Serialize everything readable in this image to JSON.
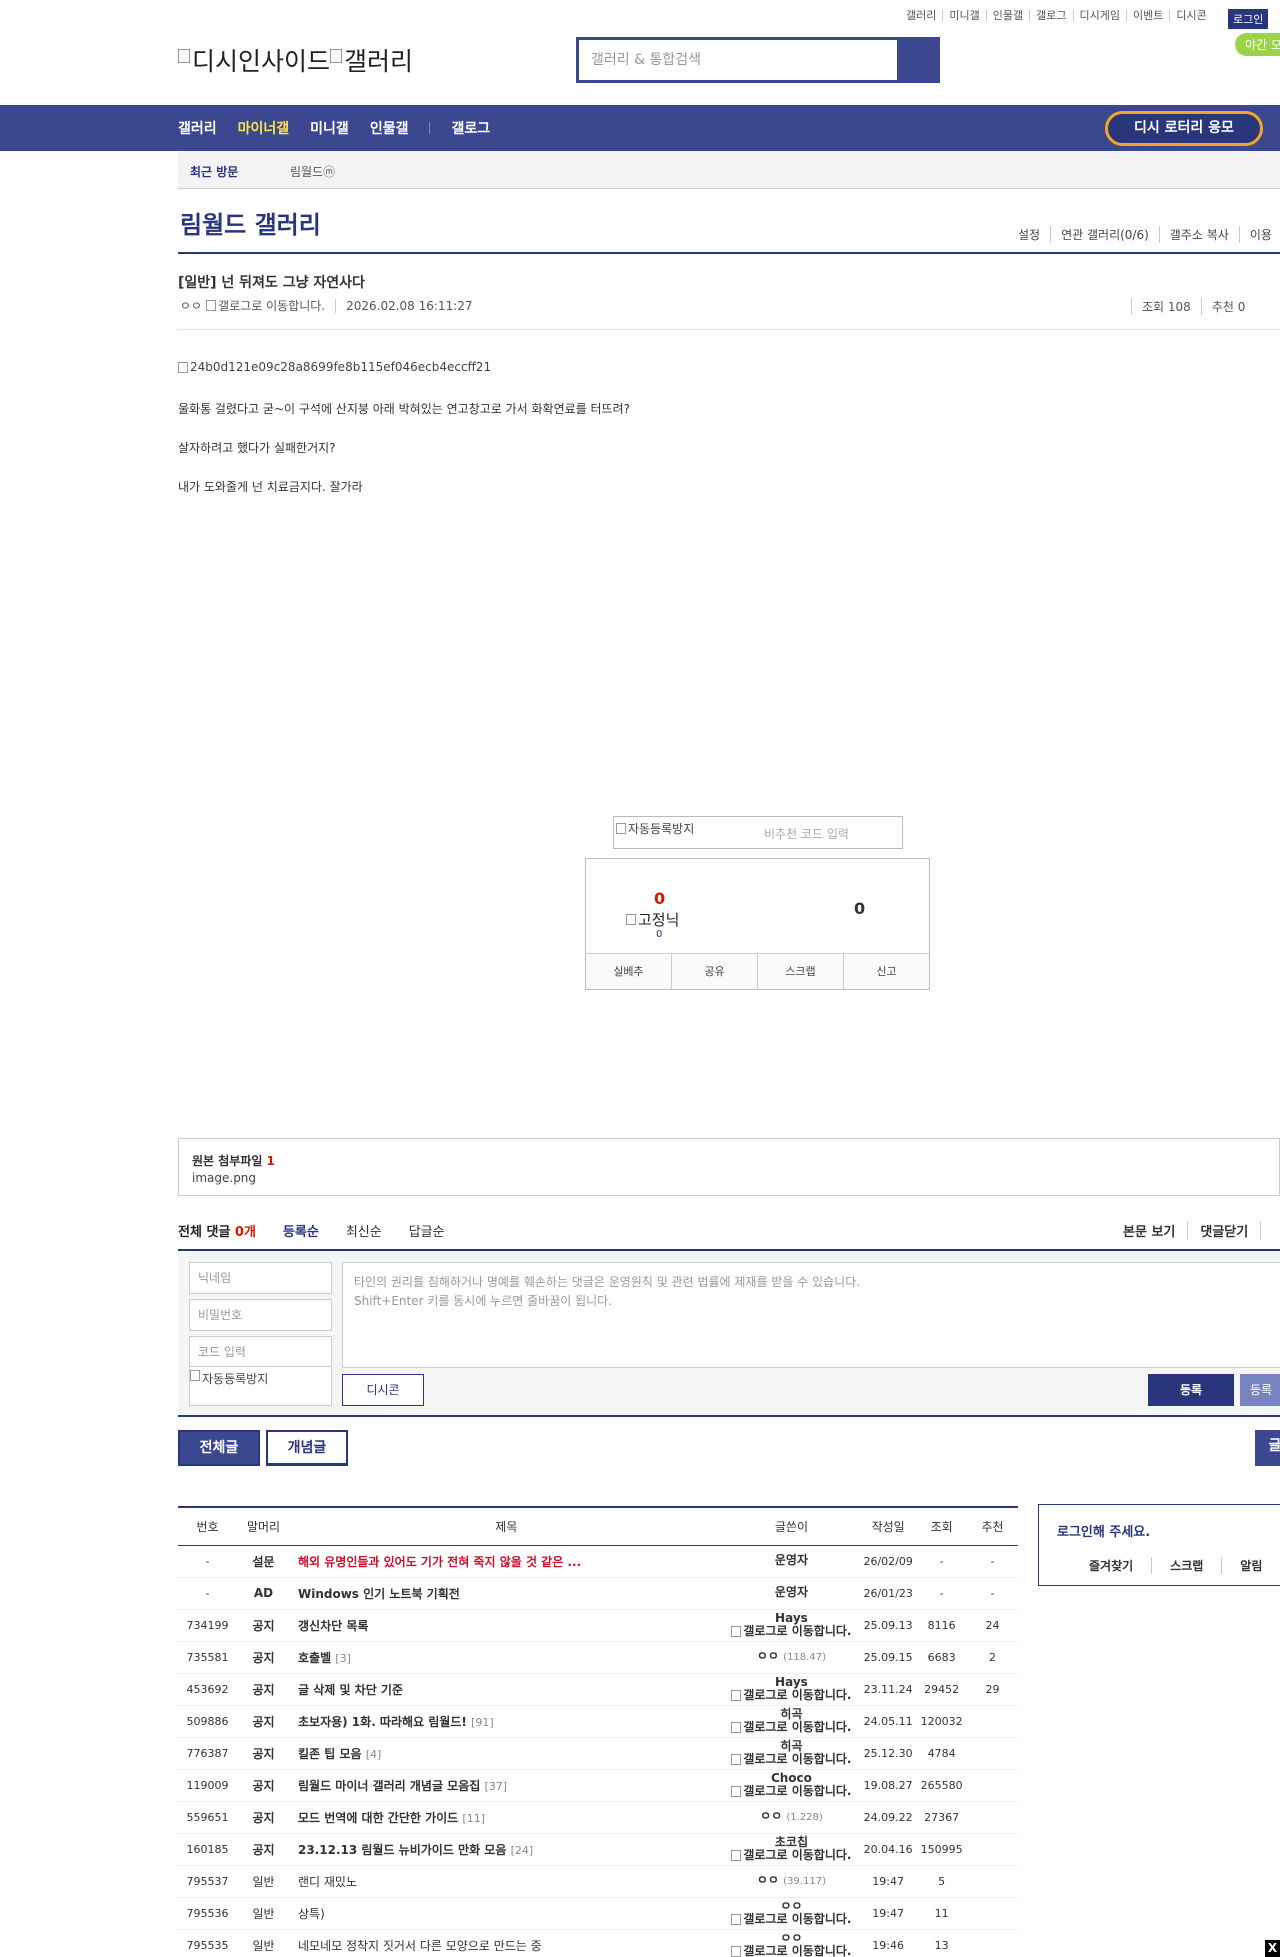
{
  "top_links": [
    "갤러리",
    "미니갤",
    "인물갤",
    "갤로그",
    "디시게임",
    "이벤트",
    "디시콘"
  ],
  "login_label": "로그인",
  "night_mode_label": "야간 모",
  "logo_alt_1": "디시인사이드",
  "logo_alt_2": "갤러리",
  "search": {
    "placeholder": "갤러리 & 통합검색"
  },
  "gnb": {
    "items": [
      "갤러리",
      "마이너갤",
      "미니갤",
      "인물갤",
      "갤로그"
    ],
    "lotto_label": "디시 로터리 응모"
  },
  "visit": {
    "title": "최근 방문",
    "gallery": "림월드ⓜ"
  },
  "gallery": {
    "title": "림월드 갤러리",
    "menu": [
      "설정",
      "연관 갤러리(0/6)",
      "갤주소 복사",
      "이용"
    ]
  },
  "post": {
    "title": "[일반] 넌 뒤져도 그냥 자연사다",
    "author": "ㅇㅇ",
    "author_alt": "갤로그로 이동합니다.",
    "date": "2026.02.08 16:11:27",
    "views": "조회 108",
    "recommend": "추천 0",
    "image_alt": "24b0d121e09c28a8699fe8b115ef046ecb4eccff21",
    "paragraphs": [
      "울화통 걸렸다고 굳~이 구석에 산지붕 아래 박혀있는 연고창고로 가서 화확연료를 터뜨려?",
      "살자하려고 했다가 실패한거지?",
      "내가 도와줄게 넌 치료금지다. 잘가라"
    ]
  },
  "captcha": {
    "alt": "자동등록방지",
    "placeholder": "비추천 코드 입력"
  },
  "recommend_box": {
    "up": "0",
    "fixed_alt": "고정닉",
    "fixed_count": "0",
    "down": "0",
    "buttons": [
      "실베추",
      "공유",
      "스크랩",
      "신고"
    ]
  },
  "attach": {
    "title": "원본 첨부파일",
    "count": "1",
    "file": "image.png"
  },
  "comments": {
    "title": "전체 댓글",
    "count": "0개",
    "sorts": [
      "등록순",
      "최신순",
      "답글순"
    ],
    "right": [
      "본문 보기",
      "댓글닫기"
    ],
    "nickname_ph": "닉네임",
    "password_ph": "비밀번호",
    "code_ph": "코드 입력",
    "captcha_alt": "자동등록방지",
    "textarea_line1": "타인의 권리를 침해하거나 명예를 훼손하는 댓글은 운영원칙 및 관련 법률에 제재를 받을 수 있습니다.",
    "textarea_line2": "Shift+Enter 키를 동시에 누르면 줄바꿈이 됩니다.",
    "dccon": "디시콘",
    "register": "등록",
    "register2": "등록"
  },
  "tabs": {
    "all": "전체글",
    "concept": "개념글",
    "right": "글"
  },
  "list": {
    "headers": [
      "번호",
      "말머리",
      "제목",
      "글쓴이",
      "작성일",
      "조회",
      "추천"
    ],
    "rows": [
      {
        "no": "-",
        "head": "설문",
        "title": "해외 유명인들과 있어도 기가 전혀 죽지 않을 것 같은 ...",
        "reply": "",
        "writer": "운영자",
        "ip": "",
        "icon": false,
        "date": "26/02/09",
        "views": "-",
        "rec": "-",
        "style": "red"
      },
      {
        "no": "-",
        "head": "AD",
        "title": "Windows 인기 노트북 기획전",
        "reply": "",
        "writer": "운영자",
        "ip": "",
        "icon": false,
        "date": "26/01/23",
        "views": "-",
        "rec": "-",
        "style": "b"
      },
      {
        "no": "734199",
        "head": "공지",
        "title": "갱신차단 목록",
        "reply": "",
        "writer": "Hays",
        "ip": "",
        "icon": true,
        "date": "25.09.13",
        "views": "8116",
        "rec": "24",
        "style": "b"
      },
      {
        "no": "735581",
        "head": "공지",
        "title": "호출벨",
        "reply": "[3]",
        "writer": "ㅇㅇ",
        "ip": "(118.47)",
        "icon": false,
        "date": "25.09.15",
        "views": "6683",
        "rec": "2",
        "style": "b"
      },
      {
        "no": "453692",
        "head": "공지",
        "title": "글 삭제 및 차단 기준",
        "reply": "",
        "writer": "Hays",
        "ip": "",
        "icon": true,
        "date": "23.11.24",
        "views": "29452",
        "rec": "29",
        "style": "b"
      },
      {
        "no": "509886",
        "head": "공지",
        "title": "초보자용) 1화. 따라해요 림월드!",
        "reply": "[91]",
        "writer": "히곡",
        "ip": "",
        "icon": true,
        "date": "24.05.11",
        "views": "120032",
        "rec": "",
        "style": "b"
      },
      {
        "no": "776387",
        "head": "공지",
        "title": "킬존 팁 모음",
        "reply": "[4]",
        "writer": "히곡",
        "ip": "",
        "icon": true,
        "date": "25.12.30",
        "views": "4784",
        "rec": "",
        "style": "b"
      },
      {
        "no": "119009",
        "head": "공지",
        "title": "림월드 마이너 갤러리 개념글 모음집",
        "reply": "[37]",
        "writer": "Choco",
        "ip": "",
        "icon": true,
        "date": "19.08.27",
        "views": "265580",
        "rec": "",
        "style": "b"
      },
      {
        "no": "559651",
        "head": "공지",
        "title": "모드 번역에 대한 간단한 가이드",
        "reply": "[11]",
        "writer": "ㅇㅇ",
        "ip": "(1.228)",
        "icon": false,
        "date": "24.09.22",
        "views": "27367",
        "rec": "",
        "style": "b"
      },
      {
        "no": "160185",
        "head": "공지",
        "title": "23.12.13 림월드 뉴비가이드 만화 모음",
        "reply": "[24]",
        "writer": "초코칩",
        "ip": "",
        "icon": true,
        "date": "20.04.16",
        "views": "150995",
        "rec": "",
        "style": "b"
      },
      {
        "no": "795537",
        "head": "일반",
        "title": "랜디 재밌노",
        "reply": "",
        "writer": "ㅇㅇ",
        "ip": "(39.117)",
        "icon": false,
        "date": "19:47",
        "views": "5",
        "rec": "",
        "style": "n"
      },
      {
        "no": "795536",
        "head": "일반",
        "title": "상특)",
        "reply": "",
        "writer": "ㅇㅇ",
        "ip": "",
        "icon": true,
        "date": "19:47",
        "views": "11",
        "rec": "",
        "style": "n"
      },
      {
        "no": "795535",
        "head": "일반",
        "title": "네모네모 정착지 짓거서 다른 모양으로 만드는 중",
        "reply": "",
        "writer": "ㅇㅇ",
        "ip": "",
        "icon": true,
        "date": "19:46",
        "views": "13",
        "rec": "",
        "style": "n"
      }
    ],
    "icon_alt": "갤로그로 이동합니다."
  },
  "login_box": {
    "title": "로그인해 주세요.",
    "menu": [
      "즐겨찾기",
      "스크랩",
      "알림"
    ]
  },
  "close_label": "X"
}
